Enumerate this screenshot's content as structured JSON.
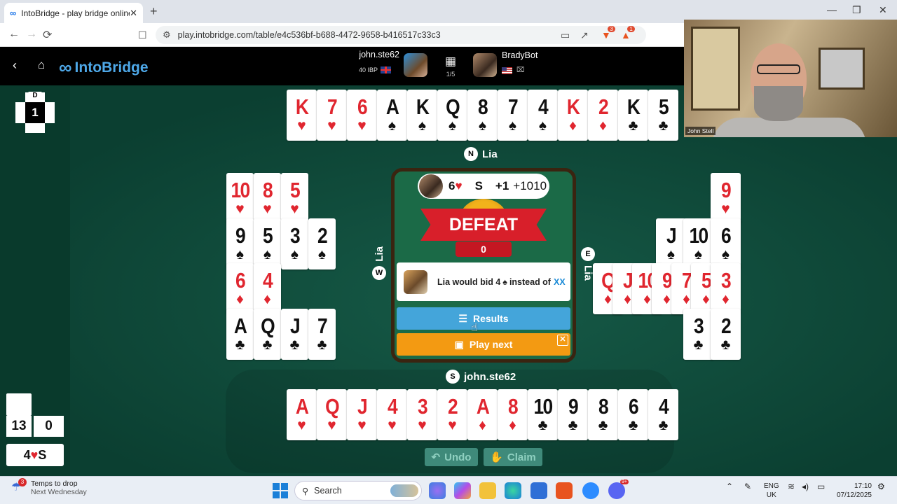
{
  "browser": {
    "tab_title": "IntoBridge - play bridge online",
    "tab_favicon": "∞",
    "tab_close": "✕",
    "new_tab": "+",
    "url": "play.intobridge.com/table/e4c536bf-b688-4472-9658-b416517c33c3",
    "ext_badge_1": "3",
    "ext_badge_2": "1",
    "window_controls": [
      "—",
      "❐",
      "✕"
    ]
  },
  "app": {
    "logo_text": "IntoBridge",
    "logo_symbol": "∞",
    "player1": {
      "name": "john.ste62",
      "rating": "40 IBP",
      "flag": "uk"
    },
    "player2": {
      "name": "BradyBot",
      "flag": "us"
    },
    "board_counter": "1/5",
    "dealer_label": "D",
    "board_number": "1"
  },
  "table": {
    "north": {
      "seat_letter": "N",
      "name": "Lia",
      "cards": [
        {
          "rank": "K",
          "suit": "♥",
          "color": "red"
        },
        {
          "rank": "7",
          "suit": "♥",
          "color": "red"
        },
        {
          "rank": "6",
          "suit": "♥",
          "color": "red"
        },
        {
          "rank": "A",
          "suit": "♠",
          "color": "black"
        },
        {
          "rank": "K",
          "suit": "♠",
          "color": "black"
        },
        {
          "rank": "Q",
          "suit": "♠",
          "color": "black"
        },
        {
          "rank": "8",
          "suit": "♠",
          "color": "black"
        },
        {
          "rank": "7",
          "suit": "♠",
          "color": "black"
        },
        {
          "rank": "4",
          "suit": "♠",
          "color": "black"
        },
        {
          "rank": "K",
          "suit": "♦",
          "color": "red"
        },
        {
          "rank": "2",
          "suit": "♦",
          "color": "red"
        },
        {
          "rank": "K",
          "suit": "♣",
          "color": "black"
        },
        {
          "rank": "5",
          "suit": "♣",
          "color": "black"
        }
      ]
    },
    "west": {
      "seat_letter": "W",
      "name": "Lia",
      "rows": [
        [
          {
            "rank": "10",
            "suit": "♥",
            "color": "red"
          },
          {
            "rank": "8",
            "suit": "♥",
            "color": "red"
          },
          {
            "rank": "5",
            "suit": "♥",
            "color": "red"
          }
        ],
        [
          {
            "rank": "9",
            "suit": "♠",
            "color": "black"
          },
          {
            "rank": "5",
            "suit": "♠",
            "color": "black"
          },
          {
            "rank": "3",
            "suit": "♠",
            "color": "black"
          },
          {
            "rank": "2",
            "suit": "♠",
            "color": "black"
          }
        ],
        [
          {
            "rank": "6",
            "suit": "♦",
            "color": "red"
          },
          {
            "rank": "4",
            "suit": "♦",
            "color": "red"
          }
        ],
        [
          {
            "rank": "A",
            "suit": "♣",
            "color": "black"
          },
          {
            "rank": "Q",
            "suit": "♣",
            "color": "black"
          },
          {
            "rank": "J",
            "suit": "♣",
            "color": "black"
          },
          {
            "rank": "7",
            "suit": "♣",
            "color": "black"
          }
        ]
      ]
    },
    "east": {
      "seat_letter": "E",
      "name": "Lia",
      "rows": [
        [
          {
            "rank": "9",
            "suit": "♥",
            "color": "red"
          }
        ],
        [
          {
            "rank": "J",
            "suit": "♠",
            "color": "black"
          },
          {
            "rank": "10",
            "suit": "♠",
            "color": "black"
          },
          {
            "rank": "6",
            "suit": "♠",
            "color": "black"
          }
        ],
        [
          {
            "rank": "Q",
            "suit": "♦",
            "color": "red"
          },
          {
            "rank": "J",
            "suit": "♦",
            "color": "red"
          },
          {
            "rank": "10",
            "suit": "♦",
            "color": "red"
          },
          {
            "rank": "9",
            "suit": "♦",
            "color": "red"
          },
          {
            "rank": "7",
            "suit": "♦",
            "color": "red"
          },
          {
            "rank": "5",
            "suit": "♦",
            "color": "red"
          },
          {
            "rank": "3",
            "suit": "♦",
            "color": "red"
          }
        ],
        [
          {
            "rank": "3",
            "suit": "♣",
            "color": "black"
          },
          {
            "rank": "2",
            "suit": "♣",
            "color": "black"
          }
        ]
      ]
    },
    "south": {
      "seat_letter": "S",
      "name": "john.ste62",
      "cards": [
        {
          "rank": "A",
          "suit": "♥",
          "color": "red"
        },
        {
          "rank": "Q",
          "suit": "♥",
          "color": "red"
        },
        {
          "rank": "J",
          "suit": "♥",
          "color": "red"
        },
        {
          "rank": "4",
          "suit": "♥",
          "color": "red"
        },
        {
          "rank": "3",
          "suit": "♥",
          "color": "red"
        },
        {
          "rank": "2",
          "suit": "♥",
          "color": "red"
        },
        {
          "rank": "A",
          "suit": "♦",
          "color": "red"
        },
        {
          "rank": "8",
          "suit": "♦",
          "color": "red"
        },
        {
          "rank": "10",
          "suit": "♣",
          "color": "black"
        },
        {
          "rank": "9",
          "suit": "♣",
          "color": "black"
        },
        {
          "rank": "8",
          "suit": "♣",
          "color": "black"
        },
        {
          "rank": "6",
          "suit": "♣",
          "color": "black"
        },
        {
          "rank": "4",
          "suit": "♣",
          "color": "black"
        }
      ]
    }
  },
  "result": {
    "contract_level": "6",
    "contract_suit": "♥",
    "declarer": "S",
    "overtricks": "+1",
    "score": "+1010",
    "outcome": "DEFEAT",
    "points": "0",
    "hint_name": "Lia",
    "hint_mid": "would bid 4",
    "hint_suit": "♠",
    "hint_end": "instead of",
    "hint_alt": "XX",
    "results_label": "Results",
    "play_next_label": "Play next"
  },
  "scoreboard": {
    "tricks_ns": "13",
    "tricks_ew": "0",
    "contract_level": "4",
    "contract_suit": "♥",
    "contract_declarer": "S"
  },
  "controls": {
    "undo_label": "Undo",
    "claim_label": "Claim"
  },
  "webcam": {
    "name": "John Stell"
  },
  "taskbar": {
    "weather_line1": "Temps to drop",
    "weather_line2": "Next Wednesday",
    "weather_badge": "3",
    "search_placeholder": "Search",
    "discord_badge": "9+",
    "lang_line1": "ENG",
    "lang_line2": "UK",
    "time": "17:10",
    "date": "07/12/2025"
  }
}
